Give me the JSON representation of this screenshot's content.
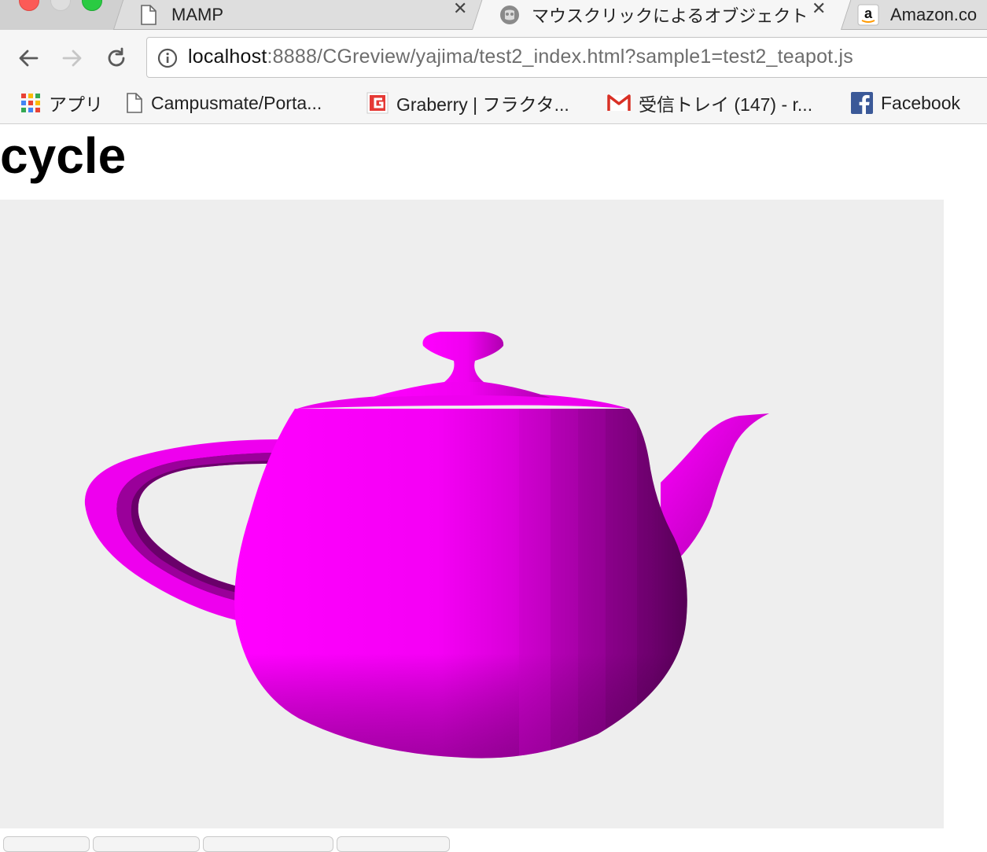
{
  "browser": {
    "tabs": [
      {
        "title": "MAMP",
        "icon": "document-icon",
        "active": false
      },
      {
        "title": "マウスクリックによるオブジェクト",
        "icon": "globe-icon",
        "active": true
      },
      {
        "title": "Amazon.co",
        "icon": "amazon-icon",
        "active": false
      }
    ],
    "address": {
      "host": "localhost",
      "rest": ":8888/CGreview/yajima/test2_index.html?sample1=test2_teapot.js",
      "security_icon": "info-icon"
    },
    "bookmarks": [
      {
        "label": "アプリ",
        "icon": "apps-grid-icon"
      },
      {
        "label": "Campusmate/Porta...",
        "icon": "document-icon"
      },
      {
        "label": "Graberry | フラクタ...",
        "icon": "graberry-icon"
      },
      {
        "label": "受信トレイ (147) - r...",
        "icon": "gmail-icon"
      },
      {
        "label": "Facebook",
        "icon": "facebook-icon"
      }
    ]
  },
  "page": {
    "heading": "cycle",
    "canvas": {
      "background": "#eeeeee",
      "object": "teapot",
      "object_color": "#ff00ff"
    }
  },
  "colors": {
    "teapot": "#ff00ff",
    "teapot_shade": "#7a007a",
    "canvas_bg": "#eeeeee"
  }
}
